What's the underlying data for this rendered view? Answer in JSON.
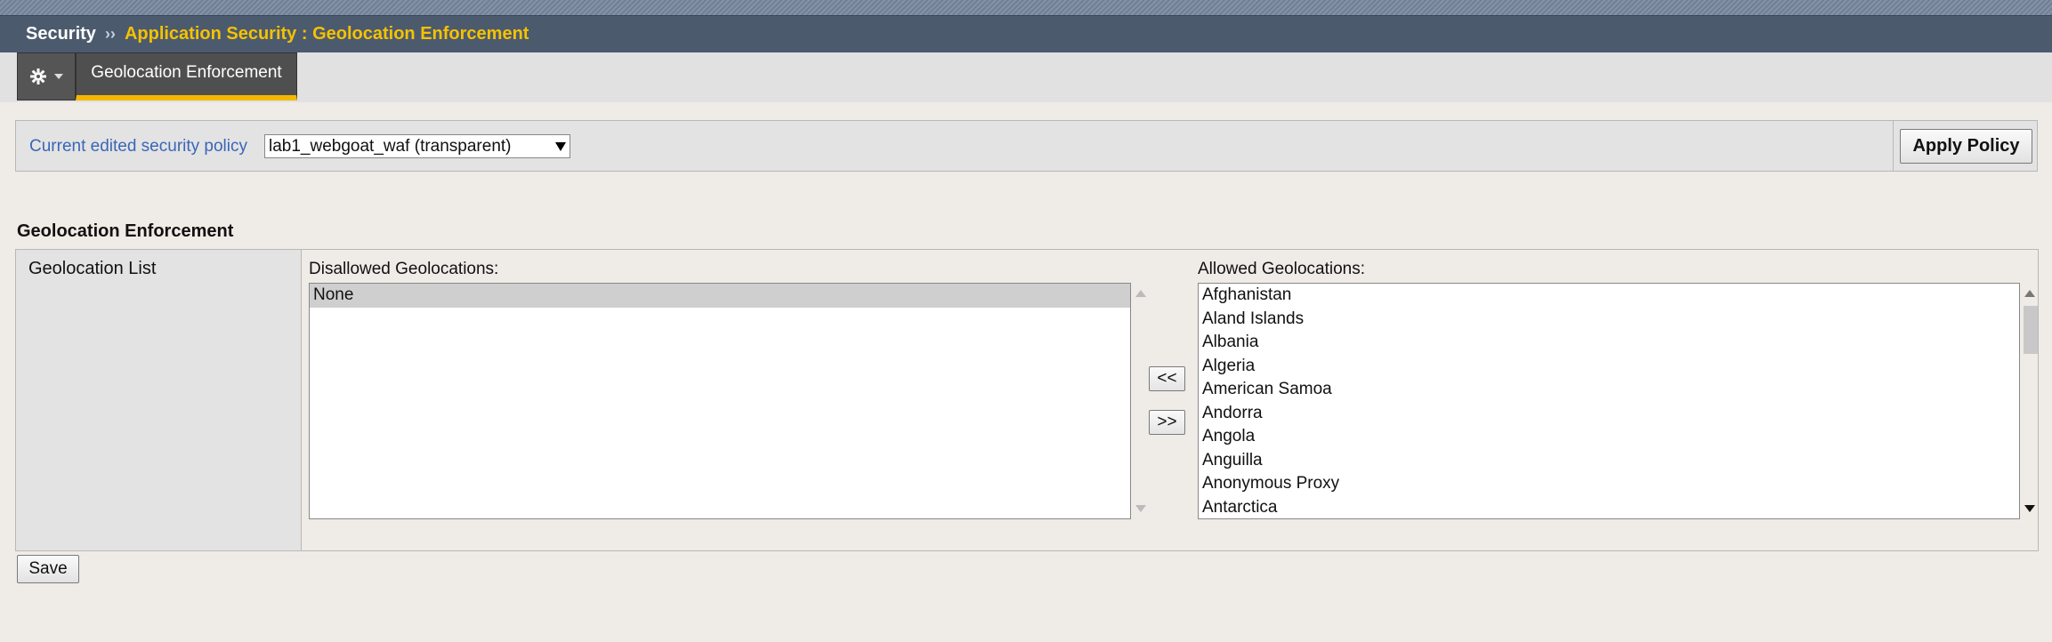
{
  "breadcrumb": {
    "root": "Security",
    "separator": "››",
    "current": "Application Security : Geolocation Enforcement"
  },
  "tabs": {
    "gear_icon": "gear-icon",
    "active_tab": "Geolocation Enforcement"
  },
  "policy": {
    "label": "Current edited security policy",
    "selected": "lab1_webgoat_waf (transparent)",
    "apply_label": "Apply Policy"
  },
  "section": {
    "title": "Geolocation Enforcement",
    "row_label": "Geolocation List"
  },
  "disallowed": {
    "title": "Disallowed Geolocations:",
    "items": [
      "None"
    ]
  },
  "allowed": {
    "title": "Allowed Geolocations:",
    "items": [
      "Afghanistan",
      "Aland Islands",
      "Albania",
      "Algeria",
      "American Samoa",
      "Andorra",
      "Angola",
      "Anguilla",
      "Anonymous Proxy",
      "Antarctica"
    ]
  },
  "buttons": {
    "move_left": "<<",
    "move_right": ">>",
    "save": "Save"
  },
  "colors": {
    "breadcrumb_bg": "#4c5a6e",
    "breadcrumb_accent": "#f5c200",
    "tab_underline": "#f5b800",
    "link_blue": "#3a66b8"
  }
}
